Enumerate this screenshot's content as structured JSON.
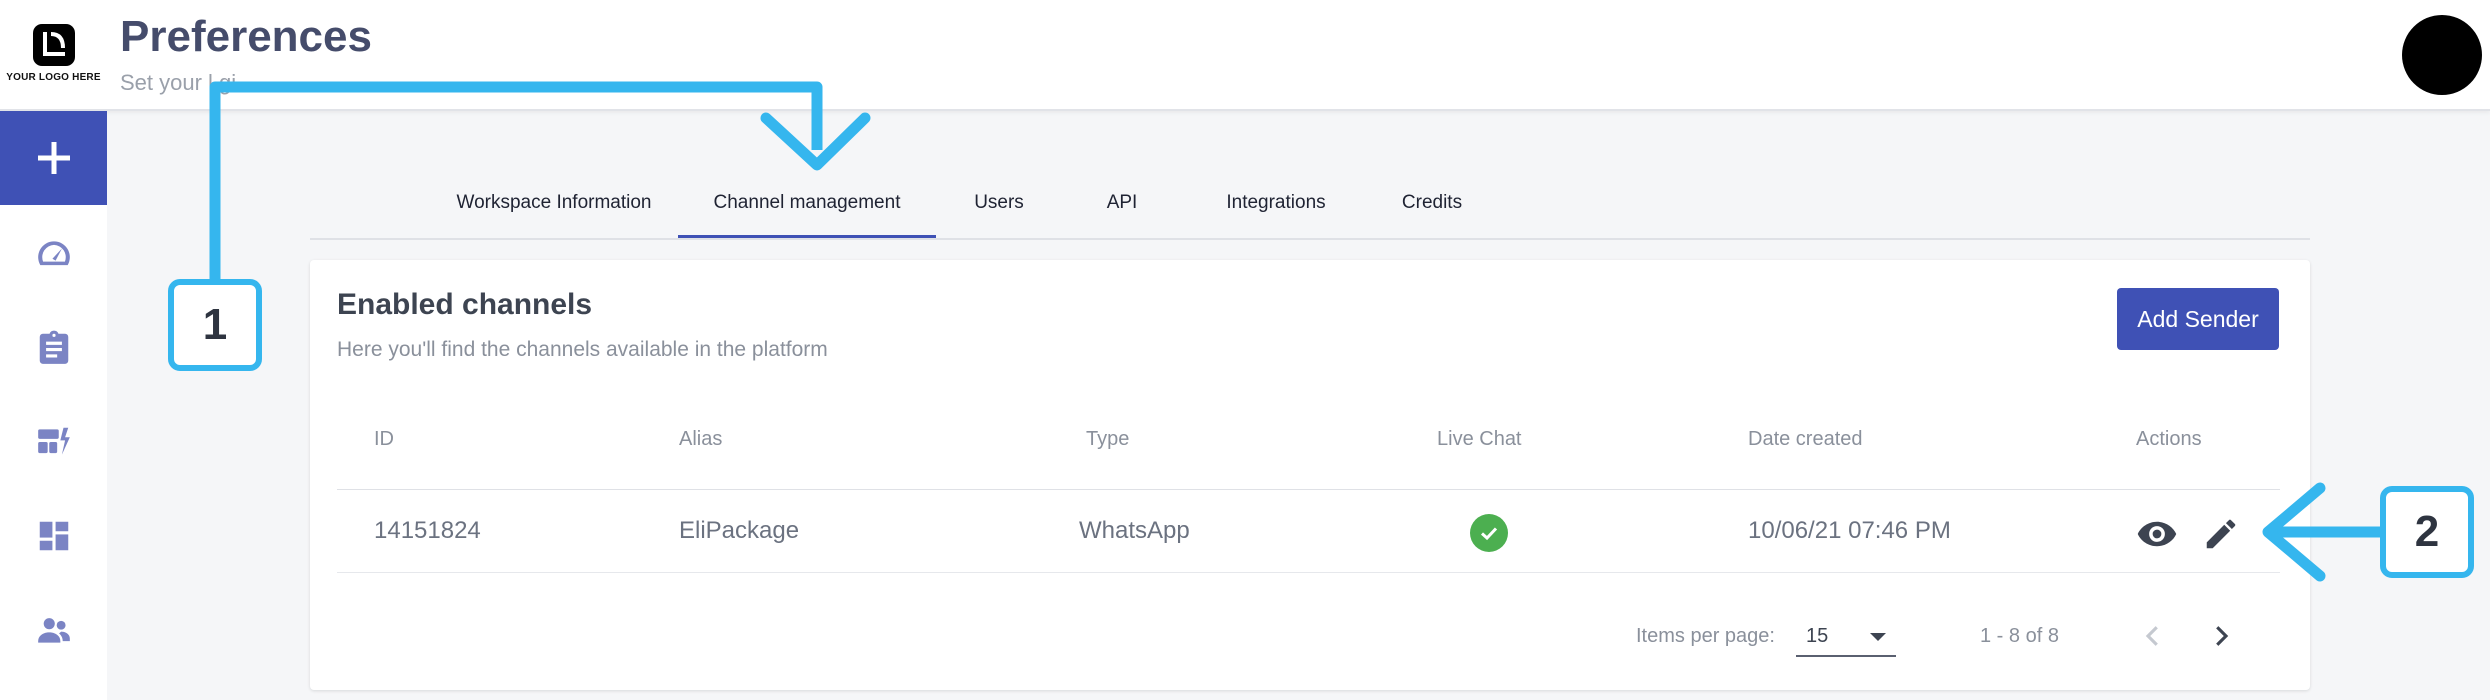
{
  "header": {
    "logo_text": "YOUR LOGO HERE",
    "title": "Preferences",
    "subtitle": "Set your l          gi"
  },
  "sidebar": {
    "new_icon": "plus-icon",
    "items": [
      {
        "icon": "dashboard-speedometer-icon"
      },
      {
        "icon": "clipboard-icon"
      },
      {
        "icon": "campaigns-flash-icon"
      },
      {
        "icon": "dashboard-grid-icon"
      },
      {
        "icon": "people-icon"
      }
    ]
  },
  "tabs": [
    {
      "label": "Workspace Information",
      "active": false
    },
    {
      "label": "Channel management",
      "active": true
    },
    {
      "label": "Users",
      "active": false
    },
    {
      "label": "API",
      "active": false
    },
    {
      "label": "Integrations",
      "active": false
    },
    {
      "label": "Credits",
      "active": false
    }
  ],
  "card": {
    "title": "Enabled channels",
    "subtitle": "Here you'll find the channels available in the platform",
    "add_button": "Add Sender"
  },
  "table": {
    "columns": [
      "ID",
      "Alias",
      "Type",
      "Live Chat",
      "Date created",
      "Actions"
    ],
    "rows": [
      {
        "id": "14151824",
        "alias": "EliPackage",
        "type": "WhatsApp",
        "live_chat": "check-circle-icon",
        "date": "10/06/21 07:46 PM",
        "actions": [
          "eye-icon",
          "pencil-icon"
        ]
      }
    ]
  },
  "pagination": {
    "label": "Items per page:",
    "per_page": "15",
    "range": "1 - 8 of 8"
  },
  "annotations": [
    {
      "number": "1"
    },
    {
      "number": "2"
    }
  ],
  "colors": {
    "primary": "#3f51b5",
    "annotation": "#35b6ee",
    "success": "#4caf50",
    "title": "#454c6b"
  }
}
